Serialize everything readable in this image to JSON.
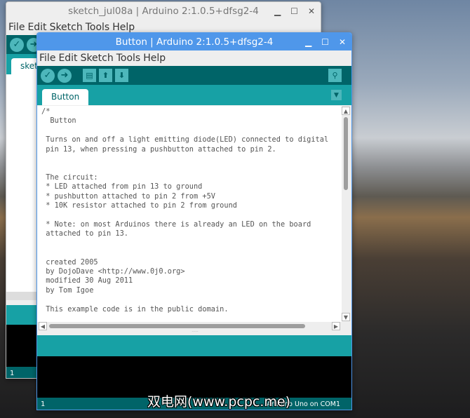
{
  "back_window": {
    "title": "sketch_jul08a | Arduino 2:1.0.5+dfsg2-4",
    "menu": [
      "File",
      "Edit",
      "Sketch",
      "Tools",
      "Help"
    ],
    "tab": "sketch_jul08a",
    "status_line": "1"
  },
  "front_window": {
    "title": "Button | Arduino 2:1.0.5+dfsg2-4",
    "menu": [
      "File",
      "Edit",
      "Sketch",
      "Tools",
      "Help"
    ],
    "toolbar": {
      "verify": "verify-icon",
      "upload": "upload-icon",
      "new": "new-icon",
      "open": "open-icon",
      "save": "save-icon",
      "serial_monitor": "serial-monitor-icon"
    },
    "tab": "Button",
    "code": "/*\n  Button\n\n Turns on and off a light emitting diode(LED) connected to digital\n pin 13, when pressing a pushbutton attached to pin 2.\n\n\n The circuit:\n * LED attached from pin 13 to ground\n * pushbutton attached to pin 2 from +5V\n * 10K resistor attached to pin 2 from ground\n\n * Note: on most Arduinos there is already an LED on the board\n attached to pin 13.\n\n\n created 2005\n by DojoDave <http://www.0j0.org>\n modified 30 Aug 2011\n by Tom Igoe\n\n This example code is in the public domain.",
    "status_line": "1",
    "board": "Arduino Uno on COM1"
  },
  "watermark": "双电网(www.pcpc.me)",
  "colors": {
    "teal_dark": "#006468",
    "teal": "#17a1a5",
    "titlebar_active": "#4f97ea"
  }
}
